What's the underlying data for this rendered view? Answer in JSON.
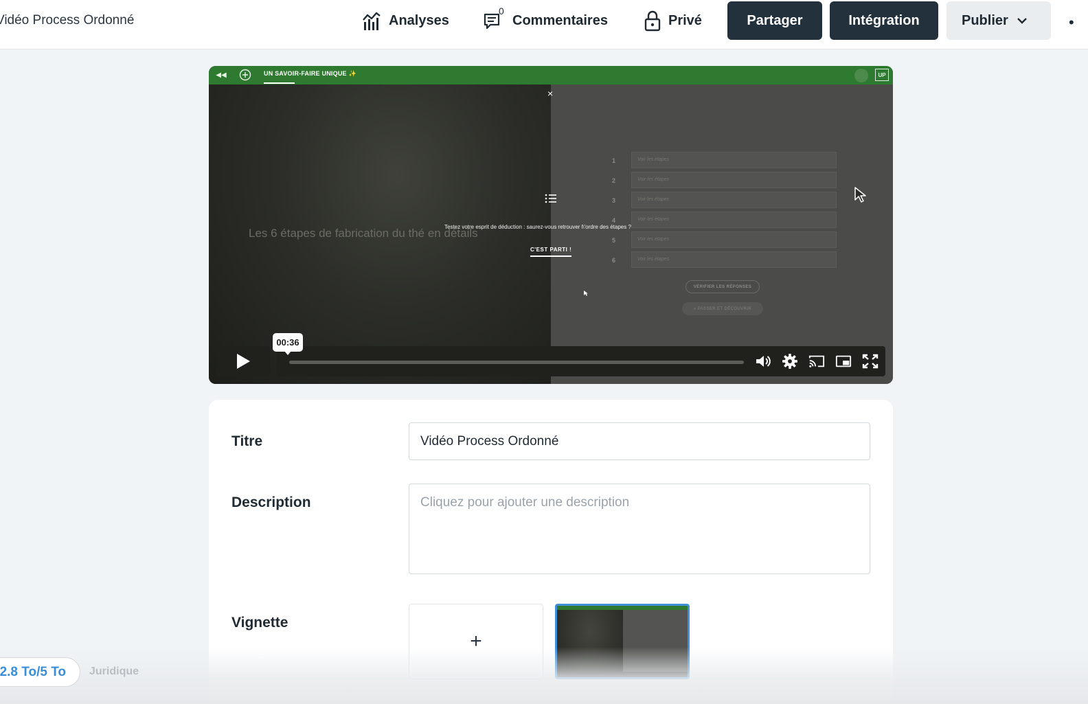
{
  "header": {
    "doc_title": "Vidéo Process Ordonné",
    "nav": {
      "analyses": "Analyses",
      "comments": "Commentaires",
      "comments_count": "0",
      "private": "Privé"
    },
    "share_label": "Partager",
    "embed_label": "Intégration",
    "publish_label": "Publier",
    "more_label": "•"
  },
  "video": {
    "top_label": "UN SAVOIR-FAIRE UNIQUE ✨",
    "up_badge": "UP",
    "heading": "Les 6 étapes de fabrication du thé en détails",
    "question": "Testez votre esprit de déduction : saurez-vous retrouver l\\'ordre des étapes ?",
    "start_label": "C'EST PARTI !",
    "close_label": "×",
    "rows": [
      {
        "num": "1",
        "placeholder": "Voir les étapes"
      },
      {
        "num": "2",
        "placeholder": "Voir les étapes"
      },
      {
        "num": "3",
        "placeholder": "Voir les étapes"
      },
      {
        "num": "4",
        "placeholder": "Voir les étapes"
      },
      {
        "num": "5",
        "placeholder": "Voir les étapes"
      },
      {
        "num": "6",
        "placeholder": "Voir les étapes"
      }
    ],
    "check_label": "VÉRIFIER LES RÉPONSES",
    "skip_label": "» PASSER ET DÉCOUVRIR",
    "time": "00:36",
    "progress_fraction": 0.0
  },
  "form": {
    "title_label": "Titre",
    "title_value": "Vidéo Process Ordonné",
    "description_label": "Description",
    "description_placeholder": "Cliquez pour ajouter une description",
    "thumbnail_label": "Vignette",
    "add_thumbnail": "+"
  },
  "footer": {
    "storage": "2.8 To/5 To",
    "legal": "Juridique"
  },
  "colors": {
    "primary_dark": "#23313d",
    "accent_blue": "#3a8ed8",
    "video_green": "#2f7a31"
  }
}
